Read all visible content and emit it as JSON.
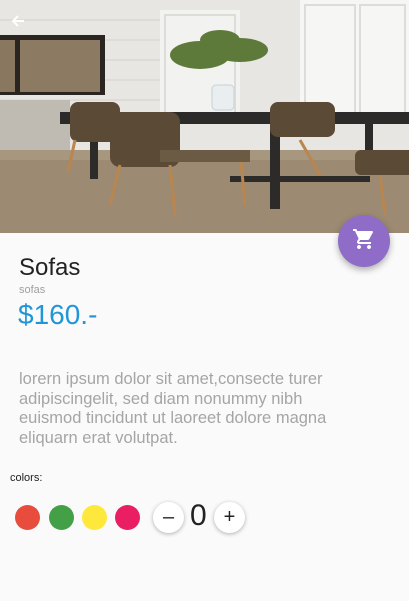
{
  "header": {
    "back_icon": "arrow-left-icon"
  },
  "cart_button": {
    "icon": "shopping-cart-icon",
    "color": "#8e6cc8"
  },
  "product": {
    "name": "Sofas",
    "category": "sofas",
    "price": "$160.-",
    "description": "lorern ipsum dolor sit amet,consecte turer adipiscingelit, sed diam nonummy nibh euismod tincidunt ut laoreet dolore magna eliquarn erat volutpat."
  },
  "colors": {
    "label": "colors:",
    "swatches": [
      {
        "name": "red",
        "hex": "#e74c3c"
      },
      {
        "name": "green",
        "hex": "#43a047"
      },
      {
        "name": "yellow",
        "hex": "#fde83b"
      },
      {
        "name": "pink",
        "hex": "#e91e63"
      }
    ]
  },
  "quantity": {
    "value": "0",
    "minus_label": "–",
    "plus_label": "+"
  },
  "theme": {
    "accent": "#2196d6",
    "fab": "#8e6cc8"
  }
}
